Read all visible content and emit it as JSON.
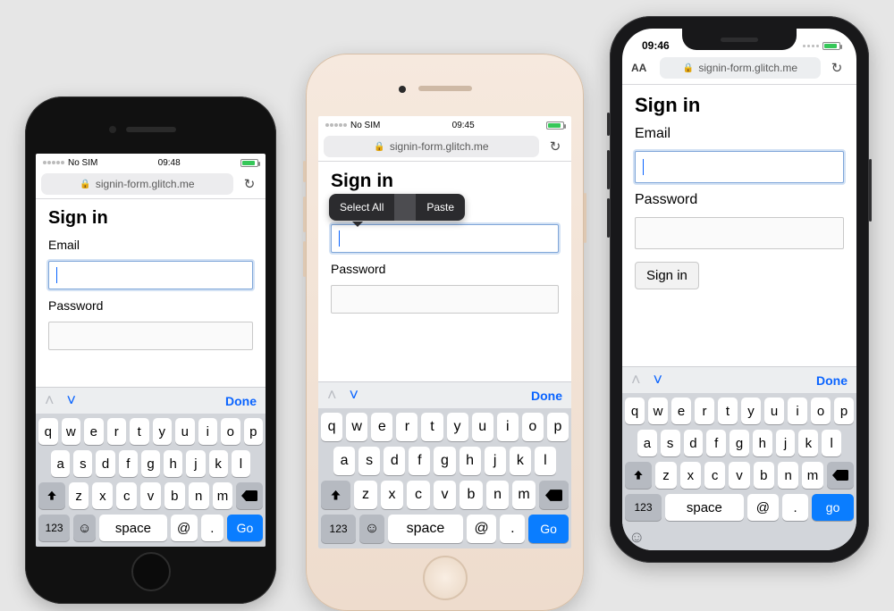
{
  "page": {
    "heading": "Sign in",
    "email_label": "Email",
    "password_label": "Password",
    "signin_button": "Sign in"
  },
  "phone1": {
    "carrier": "No SIM",
    "time": "09:48",
    "url": "signin-form.glitch.me"
  },
  "phone2": {
    "carrier": "No SIM",
    "time": "09:45",
    "url": "signin-form.glitch.me",
    "ctx_selectall": "Select All",
    "ctx_paste": "Paste"
  },
  "phone3": {
    "time": "09:46",
    "url": "signin-form.glitch.me",
    "aa": "AA"
  },
  "kb": {
    "done": "Done",
    "row1": [
      "q",
      "w",
      "e",
      "r",
      "t",
      "y",
      "u",
      "i",
      "o",
      "p"
    ],
    "row2": [
      "a",
      "s",
      "d",
      "f",
      "g",
      "h",
      "j",
      "k",
      "l"
    ],
    "row3": [
      "z",
      "x",
      "c",
      "v",
      "b",
      "n",
      "m"
    ],
    "num": "123",
    "space": "space",
    "at": "@",
    "dot": ".",
    "go": "Go",
    "go_lower": "go"
  }
}
